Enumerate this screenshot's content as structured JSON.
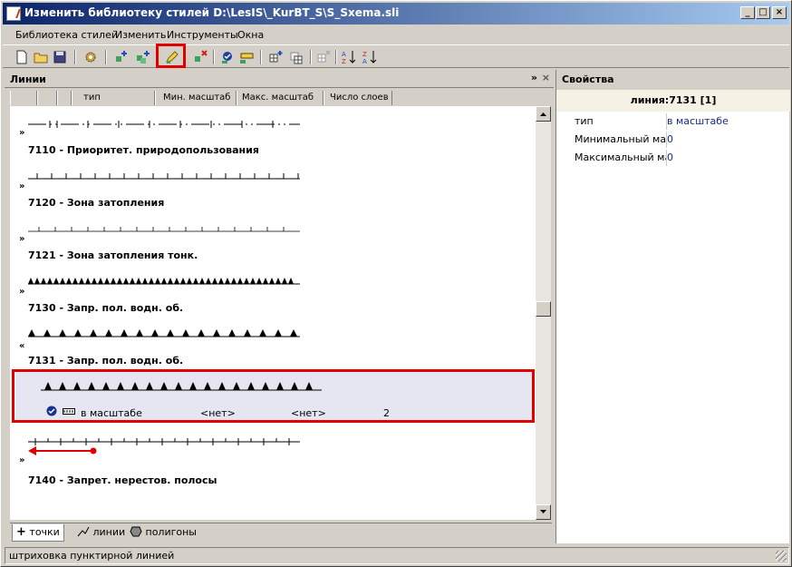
{
  "window": {
    "title": "Изменить библиотеку стилей D:\\LesIS\\_KurBT_S\\S_Sxema.sli",
    "min_label": "_",
    "max_label": "□",
    "close_label": "×"
  },
  "menu": {
    "items": [
      "Библиотека стилей",
      "Изменить",
      "Инструменты",
      "Окна"
    ]
  },
  "toolbar": {
    "icons": [
      "new-file-icon",
      "open-folder-icon",
      "save-icon",
      "settings-gear-icon",
      "add-point-icon",
      "add-copy-icon",
      "edit-style-icon",
      "delete-style-icon",
      "check-style-icon",
      "line-sample-icon",
      "grid-add-icon",
      "grid-copy-icon",
      "grid-delete-icon",
      "sort-az-icon",
      "sort-za-icon"
    ]
  },
  "left_panel": {
    "title": "Линии",
    "pin_label": "»",
    "close_label": "×",
    "columns": [
      "",
      "",
      "тип",
      "Мин. масштаб",
      "Макс. масштаб",
      "Число слоев"
    ],
    "items": [
      {
        "label": "7110 - Приоритет. природопользования",
        "pattern": "dash-ticks",
        "expanded": false
      },
      {
        "label": "7120 - Зона затопления",
        "pattern": "ticks",
        "expanded": false
      },
      {
        "label": "7121 - Зона затопления тонк.",
        "pattern": "thin-ticks",
        "expanded": false
      },
      {
        "label": "7130 - Запр. пол. водн. об.",
        "pattern": "dense-triangles",
        "expanded": false
      },
      {
        "label": "7131 - Запр. пол. водн. об.",
        "pattern": "triangles",
        "expanded": true
      },
      {
        "label": "7140 - Запрет. нерестов. полосы",
        "pattern": "small-ticks",
        "expanded": false
      }
    ],
    "expanded_detail": {
      "type": "в масштабе",
      "min_scale": "<нет>",
      "max_scale": "<нет>",
      "layers": "2"
    },
    "tabs": [
      {
        "label": "точки",
        "icon": "plus-icon",
        "active": true
      },
      {
        "label": "линии",
        "icon": "line-icon",
        "active": false
      },
      {
        "label": "полигоны",
        "icon": "polygon-icon",
        "active": false
      }
    ]
  },
  "right_panel": {
    "title": "Свойства",
    "object": "линия:7131 [1]",
    "properties": [
      {
        "name": "тип",
        "value": "в масштабе"
      },
      {
        "name": "Минимальный масштаб",
        "value": "0"
      },
      {
        "name": "Максимальный масштаб",
        "value": "0"
      }
    ]
  },
  "statusbar": {
    "text": "штриховка пунктирной линией"
  },
  "colors": {
    "titlebar_start": "#0a246a",
    "titlebar_end": "#a6caf0",
    "highlight": "#e00000",
    "selected_row": "#e6e6f2",
    "property_value": "#1a2a80"
  }
}
